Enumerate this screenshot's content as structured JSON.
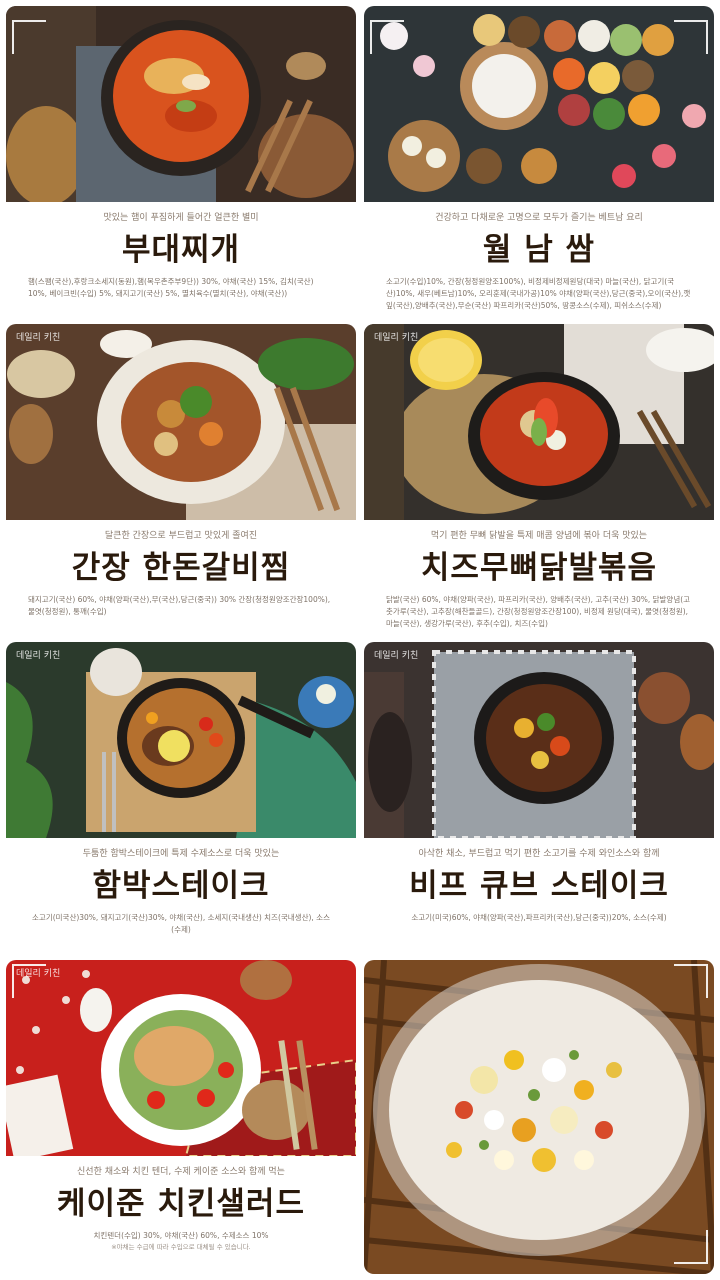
{
  "brand_label": "데일리 키친",
  "cards": [
    {
      "tagline": "맛있는 햄이 푸짐하게 들어간 얼큰한 별미",
      "title": "부대찌개",
      "ingredients": "햄(스팸(국산),후랑크소세지(동원),햄(목우촌주부9단)) 30%, 야채(국산) 15%, 김치(국산) 10%, 베이크빈(수입) 5%, 돼지고기(국산) 5%, 멸치육수(멸치(국산), 야채(국산))",
      "image_label": "budae-jjigae-photo"
    },
    {
      "tagline": "건강하고 다채로운 고명으로 모두가 즐기는 베트남 요리",
      "title": "월 남 쌈",
      "ingredients": "소고기(수입)10%, 간장(청정원양조100%), 비정제비정제원당(대국) 마늘(국산), 닭고기(국산)10%, 새우(베트남)10%, 오리훈제(국내가공)10% 야채(양파(국산),당근(중국),오이(국산),깻잎(국산),양배추(국산),무순(국산) 파프리카(국산)50%, 땅콩소스(수제), 피쉬소스(수제)",
      "image_label": "wolnam-ssam-photo"
    },
    {
      "tagline": "달큰한 간장으로 부드럽고 맛있게 졸여진",
      "title": "간장 한돈갈비찜",
      "ingredients": "돼지고기(국산) 60%, 야채(양파(국산),무(국산),당근(중국)) 30% 간장(청정원양조간장100%), 물엿(청정원), 통깨(수입)",
      "image_label": "galbi-jjim-photo"
    },
    {
      "tagline": "먹기 편한 무뼈 닭발을 특제 매콤 양념에 볶아 더욱 맛있는",
      "title": "치즈무뼈닭발볶음",
      "ingredients": "닭발(국산) 60%, 야채(양파(국산), 파프리카(국산), 양배추(국산), 고추(국산) 30%, 닭발양념(고춧가루(국산), 고추장(해찬들골드), 간장(청정원양조간장100), 비정제 원당(대국), 물엿(청정원), 마늘(국산), 생강가루(국산), 후추(수입), 치즈(수입)",
      "image_label": "dakbal-photo"
    },
    {
      "tagline": "두툼한 함박스테이크에 특제 수제소스로 더욱 맛있는",
      "title": "함박스테이크",
      "ingredients": "소고기(미국산)30%, 돼지고기(국산)30%, 야채(국산), 소세지(국내생산) 치즈(국내생산), 소스(수제)",
      "image_label": "hamburg-steak-photo"
    },
    {
      "tagline": "아삭한 채소, 부드럽고 먹기 편한 소고기를 수제 와인소스와 함께",
      "title": "비프 큐브 스테이크",
      "ingredients": "소고기(미국)60%, 야채(양파(국산),파프리카(국산),당근(중국))20%, 소스(수제)",
      "image_label": "cube-steak-photo"
    },
    {
      "tagline": "신선한 채소와 치킨 텐더, 수제 케이준 소스와 함께 먹는",
      "title": "케이준 치킨샐러드",
      "ingredients": "치킨텐더(수입) 30%, 야채(국산) 60%, 수제소스 10%",
      "note": "※야채는 수급에 따라 수입으로 대체될 수 있습니다.",
      "image_label": "cajun-salad-photo"
    },
    {
      "image_label": "salad-bowl-closeup-photo"
    }
  ]
}
